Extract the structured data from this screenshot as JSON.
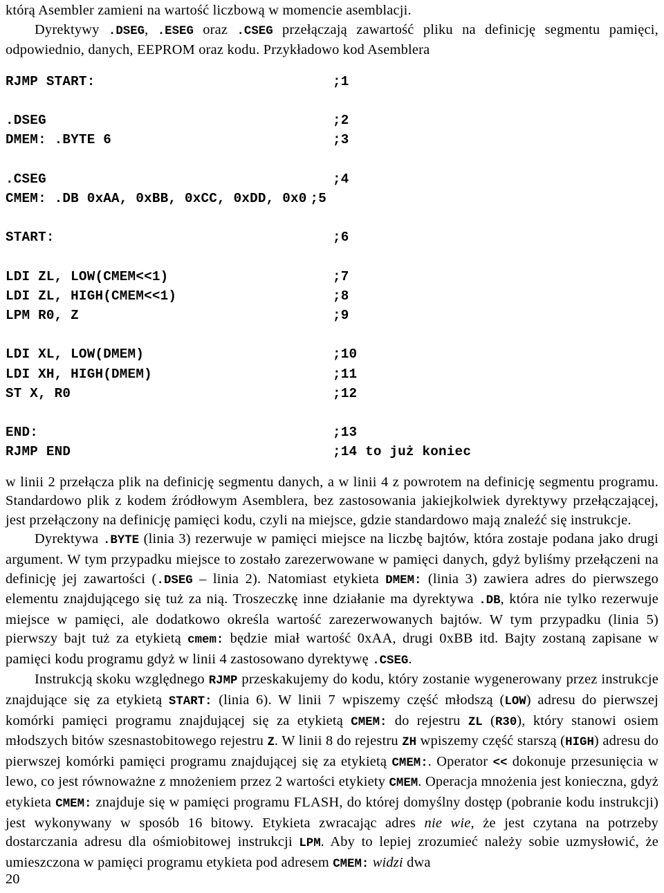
{
  "document": {
    "language": "pl",
    "page_number": "20"
  },
  "intro": {
    "line1_before": "którą Asembler zamieni na wartość liczbową w momencie asemblacji.",
    "para2_a": "Dyrektywy ",
    "para2_code1": ".DSEG",
    "para2_b": ", ",
    "para2_code2": ".ESEG",
    "para2_c": " oraz ",
    "para2_code3": ".CSEG",
    "para2_d": " przełączają zawartość pliku na definicję segmentu pamięci, odpowiednio, danych, EEPROM oraz kodu. Przykładowo kod Asemblera"
  },
  "code_listing": {
    "lines": [
      {
        "src": "RJMP START:",
        "comment": ";1"
      },
      {
        "src": "",
        "comment": ""
      },
      {
        "src": ".DSEG",
        "comment": ";2"
      },
      {
        "src": "DMEM: .BYTE 6",
        "comment": ";3"
      },
      {
        "src": "",
        "comment": ""
      },
      {
        "src": ".CSEG",
        "comment": ";4"
      },
      {
        "src": "CMEM: .DB 0xAA, 0xBB, 0xCC, 0xDD, 0x0",
        "comment": ";5",
        "wide": true
      },
      {
        "src": "",
        "comment": ""
      },
      {
        "src": "START:",
        "comment": ";6"
      },
      {
        "src": "",
        "comment": ""
      },
      {
        "src": "LDI ZL, LOW(CMEM<<1)",
        "comment": ";7"
      },
      {
        "src": "LDI ZL, HIGH(CMEM<<1)",
        "comment": ";8"
      },
      {
        "src": "LPM R0, Z",
        "comment": ";9"
      },
      {
        "src": "",
        "comment": ""
      },
      {
        "src": "LDI XL, LOW(DMEM)",
        "comment": ";10"
      },
      {
        "src": "LDI XH, HIGH(DMEM)",
        "comment": ";11"
      },
      {
        "src": "ST X, R0",
        "comment": ";12"
      },
      {
        "src": "",
        "comment": ""
      },
      {
        "src": "END:",
        "comment": ";13"
      },
      {
        "src": "RJMP END",
        "comment": ";14 to już koniec"
      }
    ]
  },
  "body": {
    "p1": "w linii 2 przełącza plik na definicję segmentu danych, a w linii 4 z powrotem na definicję segmentu programu. Standardowo plik z kodem źródłowym Asemblera, bez zastosowania jakiejkolwiek dyrektywy przełączającej, jest przełączony na definicję pamięci kodu, czyli na miejsce, gdzie standardowo mają znaleźć się instrukcje.",
    "p2_a": "Dyrektywa ",
    "p2_c1": ".BYTE",
    "p2_b": " (linia 3) rezerwuje w pamięci miejsce na liczbę bajtów, która zostaje podana jako drugi argument. W tym przypadku miejsce to zostało zarezerwowane w pamięci danych, gdyż byliśmy przełączeni na definicję jej zawartości (",
    "p2_c2": ".DSEG",
    "p2_c": " – linia 2). Natomiast etykieta ",
    "p2_c3": "DMEM:",
    "p2_d": " (linia 3) zawiera adres do pierwszego elementu znajdującego się tuż za nią. Troszeczkę inne działanie ma dyrektywa ",
    "p2_c4": ".DB",
    "p2_e": ", która nie tylko rezerwuje miejsce w pamięci, ale dodatkowo określa wartość zarezerwowanych bajtów. W tym przypadku (linia 5) pierwszy bajt tuż za etykietą ",
    "p2_c5": "cmem:",
    "p2_f": " będzie miał wartość 0xAA, drugi 0xBB itd. Bajty zostaną zapisane w pamięci kodu programu gdyż w linii 4 zastosowano dyrektywę ",
    "p2_c6": ".CSEG",
    "p2_g": ".",
    "p3_a": "Instrukcją skoku względnego ",
    "p3_c1": "RJMP",
    "p3_b": " przeskakujemy do kodu, który zostanie wygenerowany przez instrukcje znajdujące się za etykietą ",
    "p3_c2": "START:",
    "p3_c": " (linia 6). W linii 7 wpiszemy część młodszą (",
    "p3_c3": "LOW",
    "p3_d": ") adresu do pierwszej komórki pamięci programu znajdującej się za etykietą ",
    "p3_c4": "CMEM:",
    "p3_e": " do rejestru ",
    "p3_c5": "ZL",
    "p3_f": " (",
    "p3_c6": "R30",
    "p3_g": "), który stanowi osiem młodszych bitów szesnastobitowego rejestru ",
    "p3_c7": "Z",
    "p3_h": ". W linii 8 do rejestru ",
    "p3_c8": "ZH",
    "p3_i": " wpiszemy część starszą (",
    "p3_c9": "HIGH",
    "p3_j": ") adresu do pierwszej komórki pamięci programu znajdującej się za etykietą ",
    "p3_c10": "CMEM:",
    "p3_k": ". Operator ",
    "p3_c11": "<<",
    "p3_l": " dokonuje przesunięcia w lewo, co jest równoważne z mnożeniem przez 2 wartości etykiety ",
    "p3_c12": "CMEM",
    "p3_m": ". Operacja mnożenia jest konieczna, gdyż etykieta ",
    "p3_c13": "CMEM:",
    "p3_n": " znajduje się w pamięci programu FLASH, do której domyślny dostęp (pobranie kodu instrukcji) jest wykonywany w sposób 16 bitowy. Etykieta zwracając adres ",
    "p3_i1": "nie wie",
    "p3_o": ", że jest czytana na potrzeby dostarczania adresu dla ośmiobitowej instrukcji ",
    "p3_c14": "LPM",
    "p3_p": ". Aby to lepiej zrozumieć należy sobie uzmysłowić, że umieszczona w pamięci programu etykieta pod adresem ",
    "p3_c15": "CMEM:",
    "p3_q": " ",
    "p3_i2": "widzi",
    "p3_r": " dwa"
  }
}
